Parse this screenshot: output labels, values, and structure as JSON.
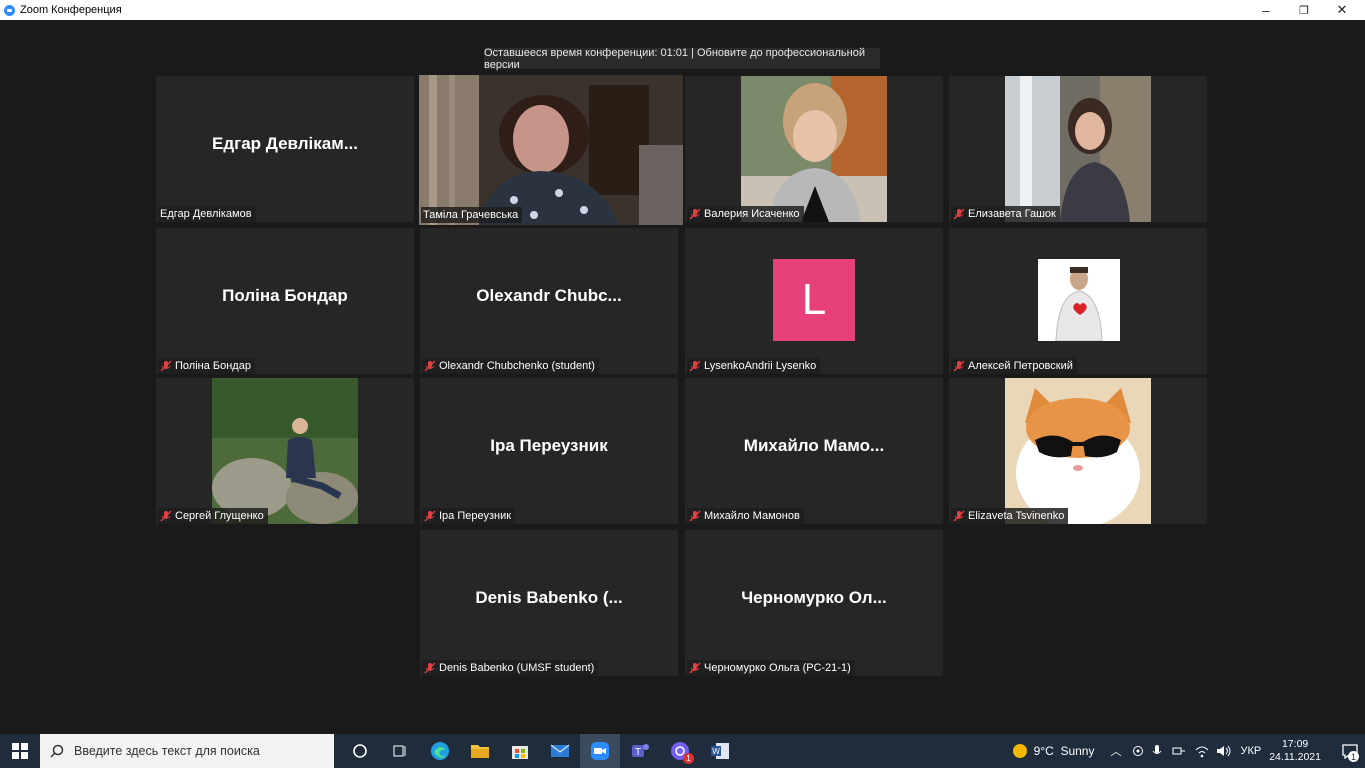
{
  "window": {
    "title": "Zoom Конференция",
    "minimize": "–",
    "restore": "❐",
    "close": "✕"
  },
  "banner": {
    "text": "Оставшееся время конференции: 01:01 | Обновите до профессиональной версии"
  },
  "participants": [
    {
      "center": "Едгар  Девлікам...",
      "label": "Едгар Девлікамов",
      "muted": false
    },
    {
      "center": "",
      "label": "Таміла Грачевська",
      "muted": false,
      "active": true
    },
    {
      "center": "",
      "label": "Валерия Исаченко",
      "muted": true
    },
    {
      "center": "",
      "label": "Елизавета Гашок",
      "muted": true
    },
    {
      "center": "Поліна Бондар",
      "label": "Поліна Бондар",
      "muted": true
    },
    {
      "center": "Olexandr  Chubc...",
      "label": "Olexandr Chubchenko (student)",
      "muted": true
    },
    {
      "center": "",
      "label": "LysenkoAndrii Lysenko",
      "muted": true,
      "avatar_letter": "L"
    },
    {
      "center": "",
      "label": "Алексей Петровский",
      "muted": true
    },
    {
      "center": "",
      "label": "Сергей Глущенко",
      "muted": true
    },
    {
      "center": "Іра Переузник",
      "label": "Іра Переузник",
      "muted": true
    },
    {
      "center": "Михайло  Мамо...",
      "label": "Михайло Мамонов",
      "muted": true
    },
    {
      "center": "",
      "label": "Elizaveta Tsvinenko",
      "muted": true
    },
    {
      "center": "Denis  Babenko  (...",
      "label": "Denis Babenko (UMSF student)",
      "muted": true
    },
    {
      "center": "Черномурко  Ол...",
      "label": "Черномурко Ольга (РС-21-1)",
      "muted": true
    }
  ],
  "taskbar": {
    "search_placeholder": "Введите здесь текст для поиска",
    "weather": "9°C  Sunny",
    "lang": "УКР",
    "time": "17:09",
    "date": "24.11.2021",
    "viber_badge": "1",
    "notifications": "1"
  },
  "colors": {
    "active_border": "#e9f27a",
    "avatar_bg": "#e8407a",
    "tile_bg": "#262626"
  }
}
